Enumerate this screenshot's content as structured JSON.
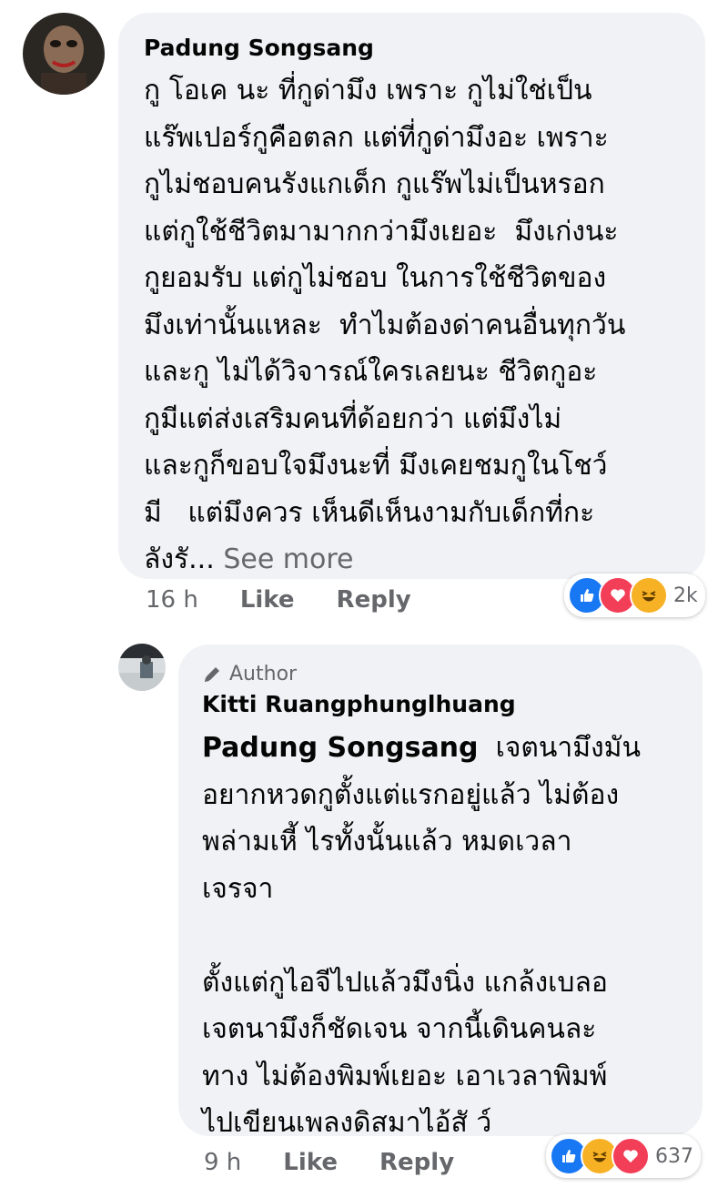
{
  "comment": {
    "author": "Padung Songsang",
    "lines": [
      "กู โอเค นะ ที่กูด่ามึง เพราะ กูไม่ใช่เป็น",
      "แร๊พเปอร์กูคือตลก แต่ที่กูด่ามึงอะ เพราะ",
      "กูไม่ชอบคนรังแกเด็ก กูแร๊พไม่เป็นหรอก",
      "แต่กูใช้ชีวิตมามากกว่ามึงเยอะ  มึงเก่งนะ",
      "กูยอมรับ แต่กูไม่ชอบ ในการใช้ชีวิตของ",
      "มึงเท่านั้นแหละ  ทำไมต้องด่าคนอื่นทุกวัน",
      "และกู ไม่ได้วิจารณ์ใครเลยนะ ชีวิตกูอะ",
      "กูมีแต่ส่งเสริมคนที่ด้อยกว่า แต่มึงไม่",
      "และกูก็ขอบใจมึงนะที่ มึงเคยชมกูในโชว์",
      "มี   แต่มึงควร เห็นดีเห็นงามกับเด็กที่กะ",
      "ลังรั..."
    ],
    "see_more": "See more",
    "time": "16 h",
    "like_label": "Like",
    "reply_label": "Reply",
    "reaction_count": "2k",
    "reaction_icons": [
      "like-icon",
      "love-icon",
      "haha-icon"
    ]
  },
  "reply": {
    "badge": "Author",
    "author": "Kitti Ruangphunglhuang",
    "mention": "Padung Songsang",
    "lines": [
      "เจตนามึงมัน",
      "อยากหวดกูตั้งแต่แรกอยู่แล้ว ไม่ต้อง",
      "พล่ามเหี้ ไรทั้งนั้นแล้ว หมดเวลา",
      "เจรจา",
      "",
      "ตั้งแต่กูไอจีไปแล้วมึงนิ่ง แกล้งเบลอ",
      "เจตนามึงก็ชัดเจน จากนี้เดินคนละ",
      "ทาง ไม่ต้องพิมพ์เยอะ เอาเวลาพิมพ์",
      "ไปเขียนเพลงดิสมาไอ้สั ว์"
    ],
    "time": "9 h",
    "like_label": "Like",
    "reply_label": "Reply",
    "reaction_count": "637",
    "reaction_icons": [
      "like-icon",
      "haha-icon",
      "love-icon"
    ]
  },
  "colors": {
    "bubble": "#f0f2f5",
    "meta": "#65676b",
    "like": "#1877f2",
    "love": "#f33e58",
    "haha": "#f7b125"
  }
}
